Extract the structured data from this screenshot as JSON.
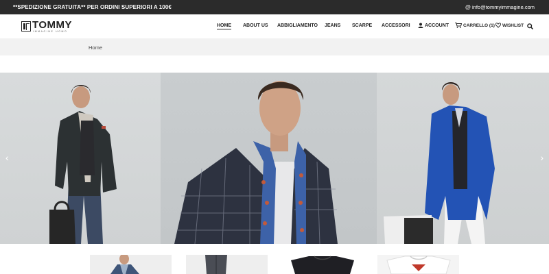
{
  "topbar": {
    "promo": "**SPEDIZIONE GRATUITA** PER ORDINI SUPERIORI A 100€",
    "email": "info@tommyimmagine.com"
  },
  "logo": {
    "name": "TOMMY",
    "sub": "IMMAGINE UOMO"
  },
  "nav": {
    "items": [
      "HOME",
      "ABOUT US",
      "ABBIGLIAMENTO",
      "JEANS",
      "SCARPE",
      "ACCESSORI"
    ],
    "account": "ACCOUNT",
    "cart": "CARRELLO (1)",
    "wishlist": "WISHLIST"
  },
  "breadcrumb": {
    "home": "Home"
  },
  "slider": {
    "prev": "‹",
    "next": "›"
  },
  "icons": [
    "user-icon",
    "cart-icon",
    "heart-icon",
    "search-icon"
  ]
}
